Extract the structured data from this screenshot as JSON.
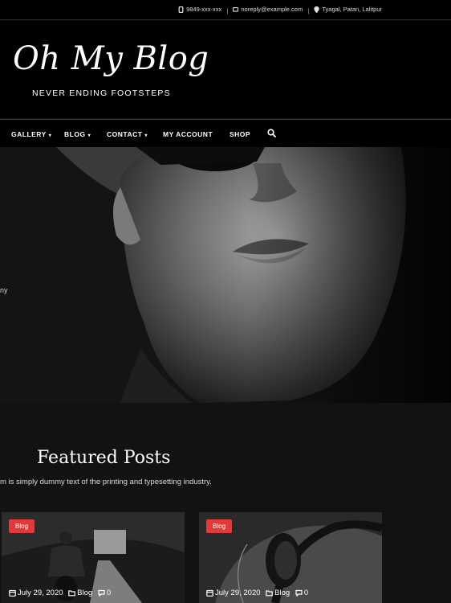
{
  "topbar": {
    "phone": "9849-xxx-xxx",
    "email": "noreply@example.com",
    "location": "Tyagal, Patan, Lalitpur",
    "separator": "|",
    "phone_icon": "phone-icon",
    "email_icon": "email-icon",
    "location_icon": "map-pin-icon"
  },
  "header": {
    "site_title": "Oh My Blog",
    "tagline": "NEVER ENDING FOOTSTEPS"
  },
  "nav": {
    "items": [
      {
        "label": "GALLERY",
        "has_dropdown": true
      },
      {
        "label": "BLOG",
        "has_dropdown": true
      },
      {
        "label": "CONTACT",
        "has_dropdown": true
      },
      {
        "label": "MY ACCOUNT",
        "has_dropdown": false
      },
      {
        "label": "SHOP",
        "has_dropdown": false
      }
    ],
    "caret": "▾",
    "search_icon": "search-icon"
  },
  "hero": {
    "text_fragment": "ny"
  },
  "featured": {
    "title": "Featured Posts",
    "subtitle": "m is simply dummy text of the printing and typesetting industry."
  },
  "posts": [
    {
      "category": "Blog",
      "date": "July 29, 2020",
      "meta_category": "Blog",
      "comments": "0"
    },
    {
      "category": "Blog",
      "date": "July 29, 2020",
      "meta_category": "Blog",
      "comments": "0"
    }
  ],
  "colors": {
    "background": "#121212",
    "header": "#000000",
    "badge": "#e03a3a"
  }
}
